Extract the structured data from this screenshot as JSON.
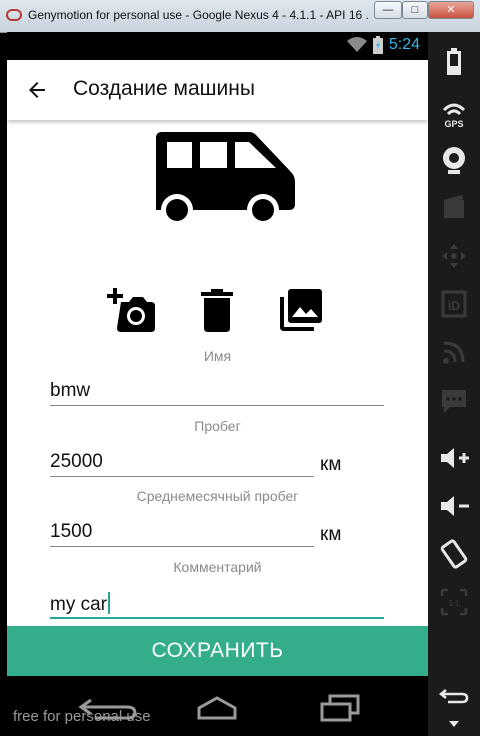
{
  "window": {
    "title": "Genymotion for personal use - Google Nexus 4 - 4.1.1 - API 16 ...",
    "min_label": "—",
    "max_label": "□",
    "close_label": "✕"
  },
  "statusbar": {
    "time": "5:24"
  },
  "appbar": {
    "title": "Создание машины"
  },
  "form": {
    "name": {
      "label": "Имя",
      "value": "bmw"
    },
    "mileage": {
      "label": "Пробег",
      "value": "25000",
      "unit": "км"
    },
    "monthly": {
      "label": "Среднемесячный пробег",
      "value": "1500",
      "unit": "км"
    },
    "comment": {
      "label": "Комментарий",
      "value": "my car"
    }
  },
  "save_button": {
    "label": "СОХРАНИТЬ"
  },
  "watermark": "free for personal use",
  "icons": [
    "back-arrow-icon",
    "van-icon",
    "add-photo-icon",
    "delete-icon",
    "gallery-icon",
    "wifi-icon",
    "battery-icon",
    "gps-icon",
    "webcam-icon",
    "media-icon",
    "dpad-icon",
    "id-icon",
    "rss-icon",
    "sms-icon",
    "volume-up-icon",
    "volume-down-icon",
    "rotate-icon",
    "scale-icon",
    "back-icon",
    "home-icon",
    "recents-icon"
  ],
  "colors": {
    "accent": "#34ad8d",
    "cursor": "#26a69a",
    "clock": "#33b5e5"
  }
}
